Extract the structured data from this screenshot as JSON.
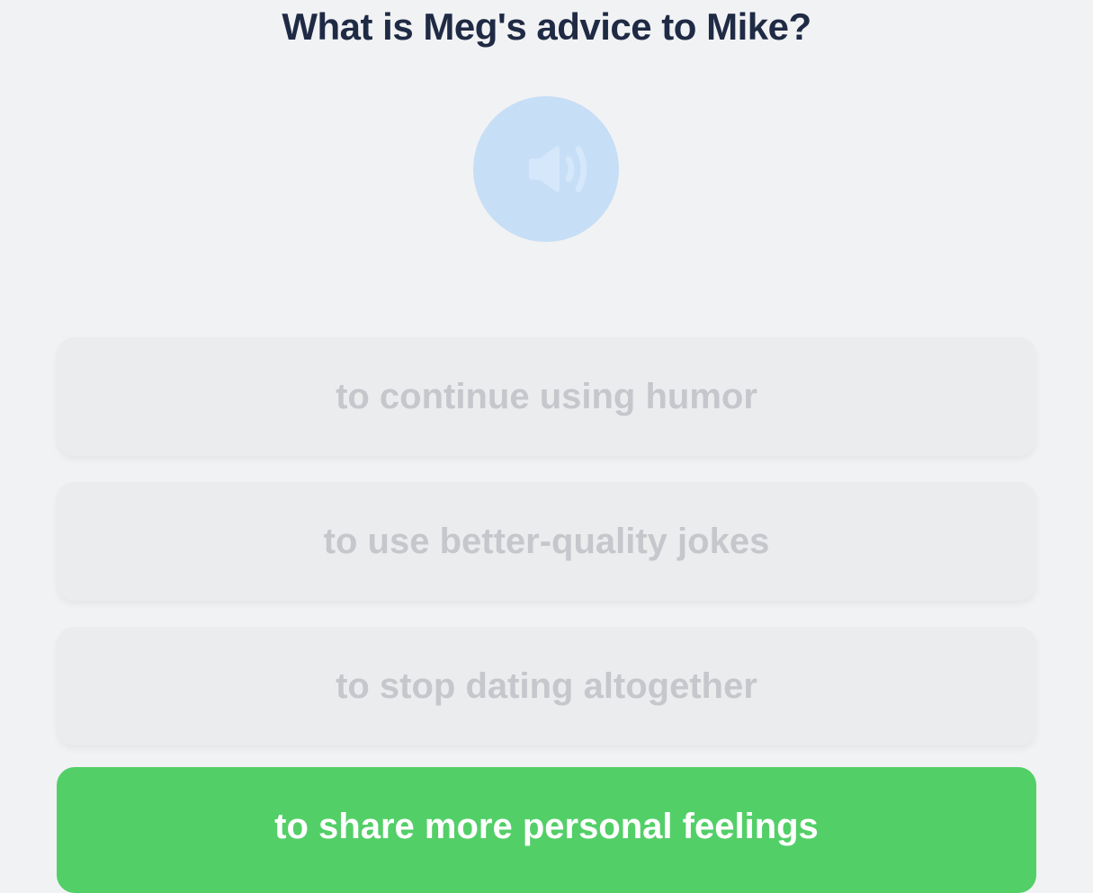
{
  "question": {
    "text": "What is Meg's advice to Mike?"
  },
  "audio": {
    "icon": "speaker-icon",
    "button_color": "#c6def6"
  },
  "options": [
    {
      "label": "to continue using humor",
      "state": "disabled"
    },
    {
      "label": "to use better-quality jokes",
      "state": "disabled"
    },
    {
      "label": "to stop dating altogether",
      "state": "disabled"
    },
    {
      "label": "to share more personal feelings",
      "state": "correct"
    }
  ],
  "colors": {
    "background": "#f1f2f4",
    "question_text": "#1f2a44",
    "option_disabled_bg": "#ebecee",
    "option_disabled_text": "#c5c7cc",
    "correct_bg": "#53cf68",
    "correct_text": "#ffffff"
  }
}
